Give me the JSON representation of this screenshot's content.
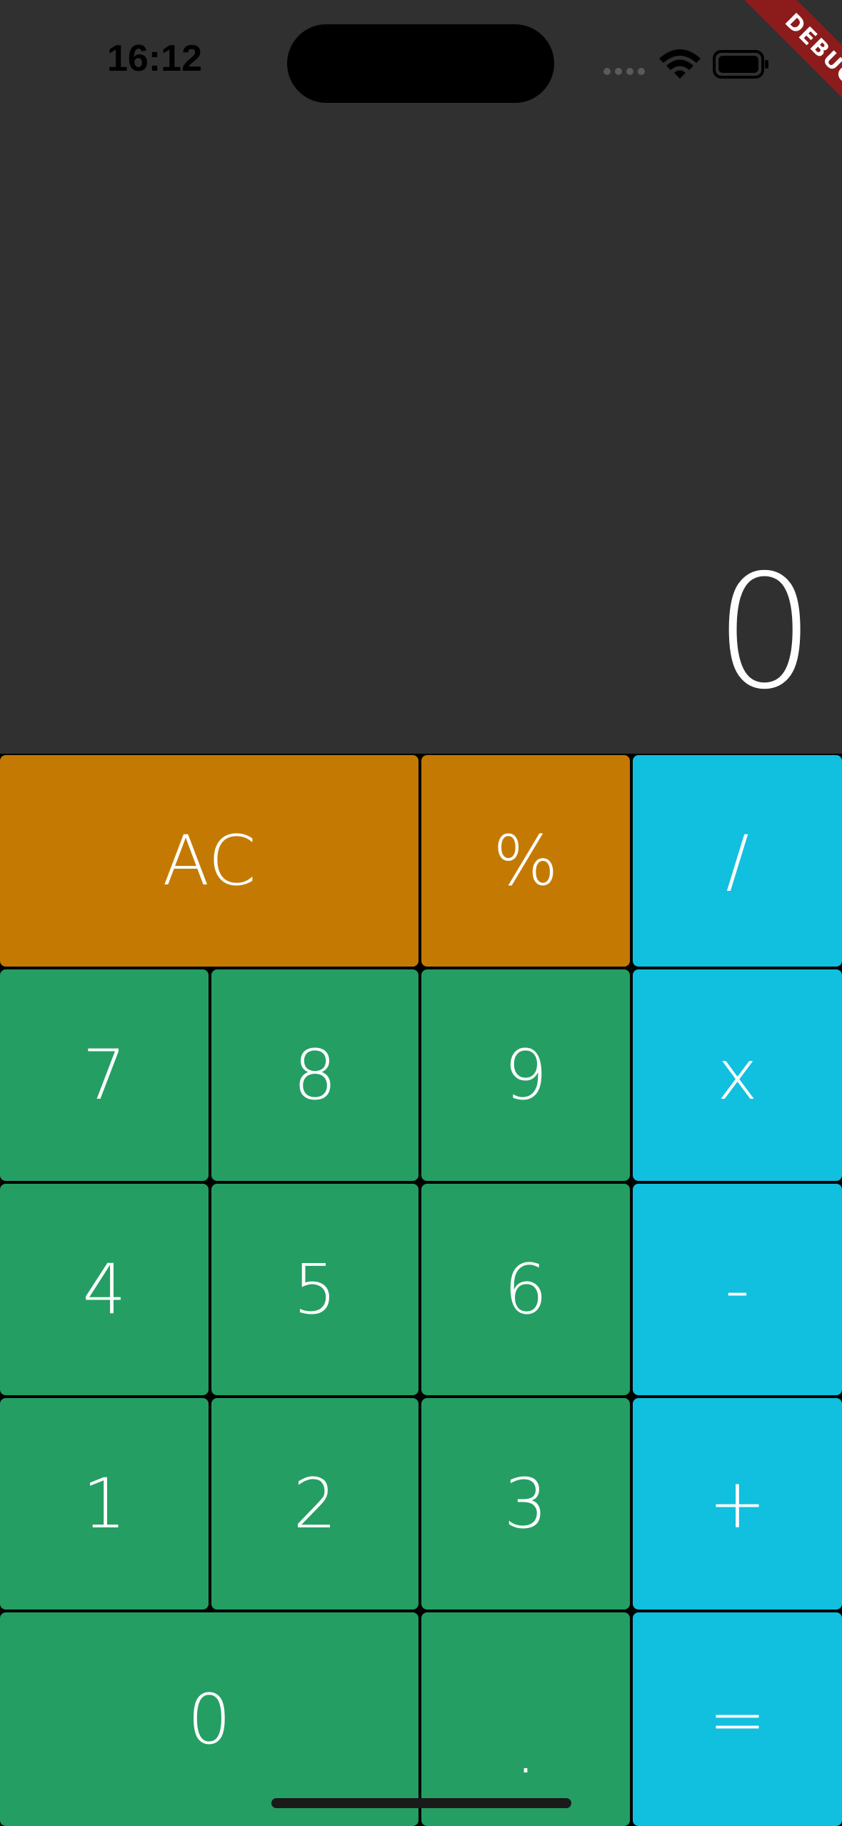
{
  "status_bar": {
    "time": "16:12",
    "icons": [
      "signal-dots-icon",
      "wifi-icon",
      "battery-icon"
    ]
  },
  "debug_banner": {
    "label": "DEBUG"
  },
  "display": {
    "value": "0"
  },
  "keys": {
    "ac": "AC",
    "percent": "%",
    "divide": "/",
    "seven": "7",
    "eight": "8",
    "nine": "9",
    "multiply": "x",
    "four": "4",
    "five": "5",
    "six": "6",
    "subtract": "-",
    "one": "1",
    "two": "2",
    "three": "3",
    "add": "+",
    "zero": "0",
    "decimal": ".",
    "equals": "="
  },
  "colors": {
    "display_background": "#303030",
    "function_key": "#c47a02",
    "operator_key": "#11bfdf",
    "number_key": "#259e63",
    "key_text": "#ffffff"
  }
}
